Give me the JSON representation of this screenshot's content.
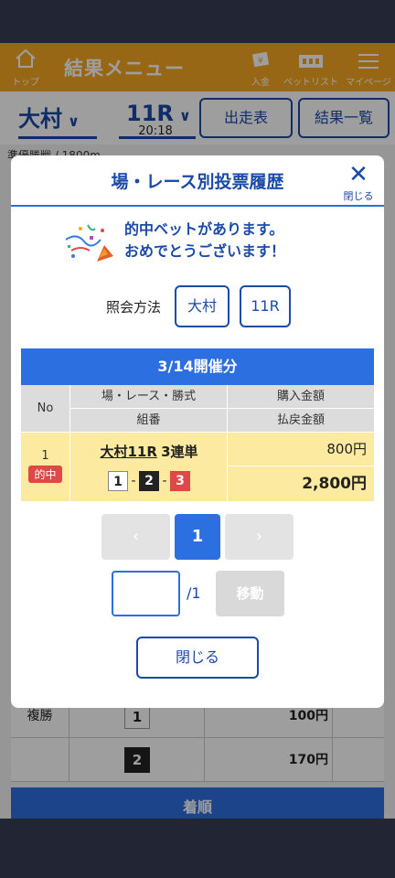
{
  "header": {
    "home_label": "トップ",
    "title": "結果メニュー",
    "deposit_label": "入金",
    "betlist_label": "ベットリスト",
    "mypage_label": "マイページ"
  },
  "selectors": {
    "venue": "大村",
    "race": "11R",
    "race_time": "20:18",
    "entries_button": "出走表",
    "results_button": "結果一覧",
    "weather_partial": "準優勝戦 / 1800m"
  },
  "background_table": {
    "rows": [
      {
        "type": "複勝",
        "number": "1",
        "amount": "100円"
      },
      {
        "type": "",
        "number": "2",
        "amount": "170円"
      }
    ],
    "section_bar": "着順"
  },
  "modal": {
    "title": "場・レース別投票履歴",
    "close_icon_label": "閉じる",
    "congrats_line1": "的中ベットがあります。",
    "congrats_line2": "おめでとうございます！",
    "lookup_label": "照会方法",
    "lookup_venue": "大村",
    "lookup_race": "11R",
    "table": {
      "date_header": "3/14開催分",
      "col_no": "No",
      "col_race_type": "場・レース・勝式",
      "col_combo": "組番",
      "col_bet_amount": "購入金額",
      "col_payout": "払戻金額",
      "rows": [
        {
          "no": "1",
          "hit_badge": "的中",
          "race_link": "大村11R",
          "bet_type": "3連単",
          "combo": [
            "1",
            "2",
            "3"
          ],
          "bet_amount": "800円",
          "payout": "2,800円"
        }
      ]
    },
    "pager": {
      "prev": "‹",
      "current": "1",
      "next": "›"
    },
    "jump": {
      "value": "",
      "total": "/1",
      "move_label": "移動"
    },
    "close_button": "閉じる"
  }
}
